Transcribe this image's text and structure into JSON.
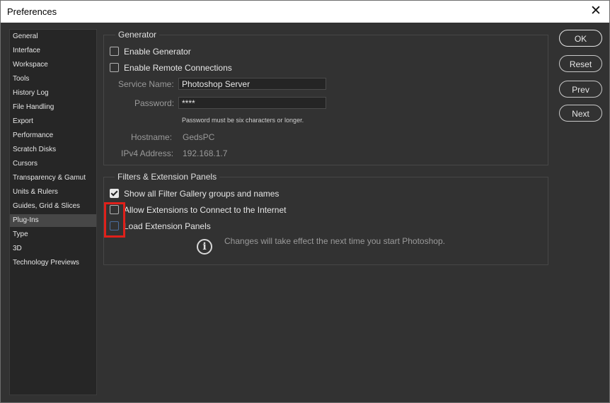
{
  "window": {
    "title": "Preferences",
    "close_glyph": "✕"
  },
  "sidebar": {
    "items": [
      {
        "label": "General"
      },
      {
        "label": "Interface"
      },
      {
        "label": "Workspace"
      },
      {
        "label": "Tools"
      },
      {
        "label": "History Log"
      },
      {
        "label": "File Handling"
      },
      {
        "label": "Export"
      },
      {
        "label": "Performance"
      },
      {
        "label": "Scratch Disks"
      },
      {
        "label": "Cursors"
      },
      {
        "label": "Transparency & Gamut"
      },
      {
        "label": "Units & Rulers"
      },
      {
        "label": "Guides, Grid & Slices"
      },
      {
        "label": "Plug-Ins"
      },
      {
        "label": "Type"
      },
      {
        "label": "3D"
      },
      {
        "label": "Technology Previews"
      }
    ],
    "active_label": "Plug-Ins"
  },
  "generator": {
    "title": "Generator",
    "enable_generator": {
      "label": "Enable Generator",
      "checked": false
    },
    "enable_remote": {
      "label": "Enable Remote Connections",
      "checked": false
    },
    "service_name_label": "Service Name:",
    "service_name_value": "Photoshop Server",
    "password_label": "Password:",
    "password_value": "****",
    "password_note": "Password must be six characters or longer.",
    "hostname_label": "Hostname:",
    "hostname_value": "GedsPC",
    "ipv4_label": "IPv4 Address:",
    "ipv4_value": "192.168.1.7"
  },
  "filters": {
    "title": "Filters & Extension Panels",
    "show_all": {
      "label": "Show all Filter Gallery groups and names",
      "checked": true
    },
    "allow_ext": {
      "label": "Allow Extensions to Connect to the Internet",
      "checked": false
    },
    "load_ext": {
      "label": "Load Extension Panels",
      "checked": false
    },
    "info_text": "Changes will take effect the next time you start Photoshop.",
    "info_icon": "info-icon"
  },
  "buttons": {
    "ok": "OK",
    "reset": "Reset",
    "prev": "Prev",
    "next": "Next"
  },
  "colors": {
    "background": "#323232",
    "panel": "#262626",
    "highlight": "#e0201a"
  }
}
